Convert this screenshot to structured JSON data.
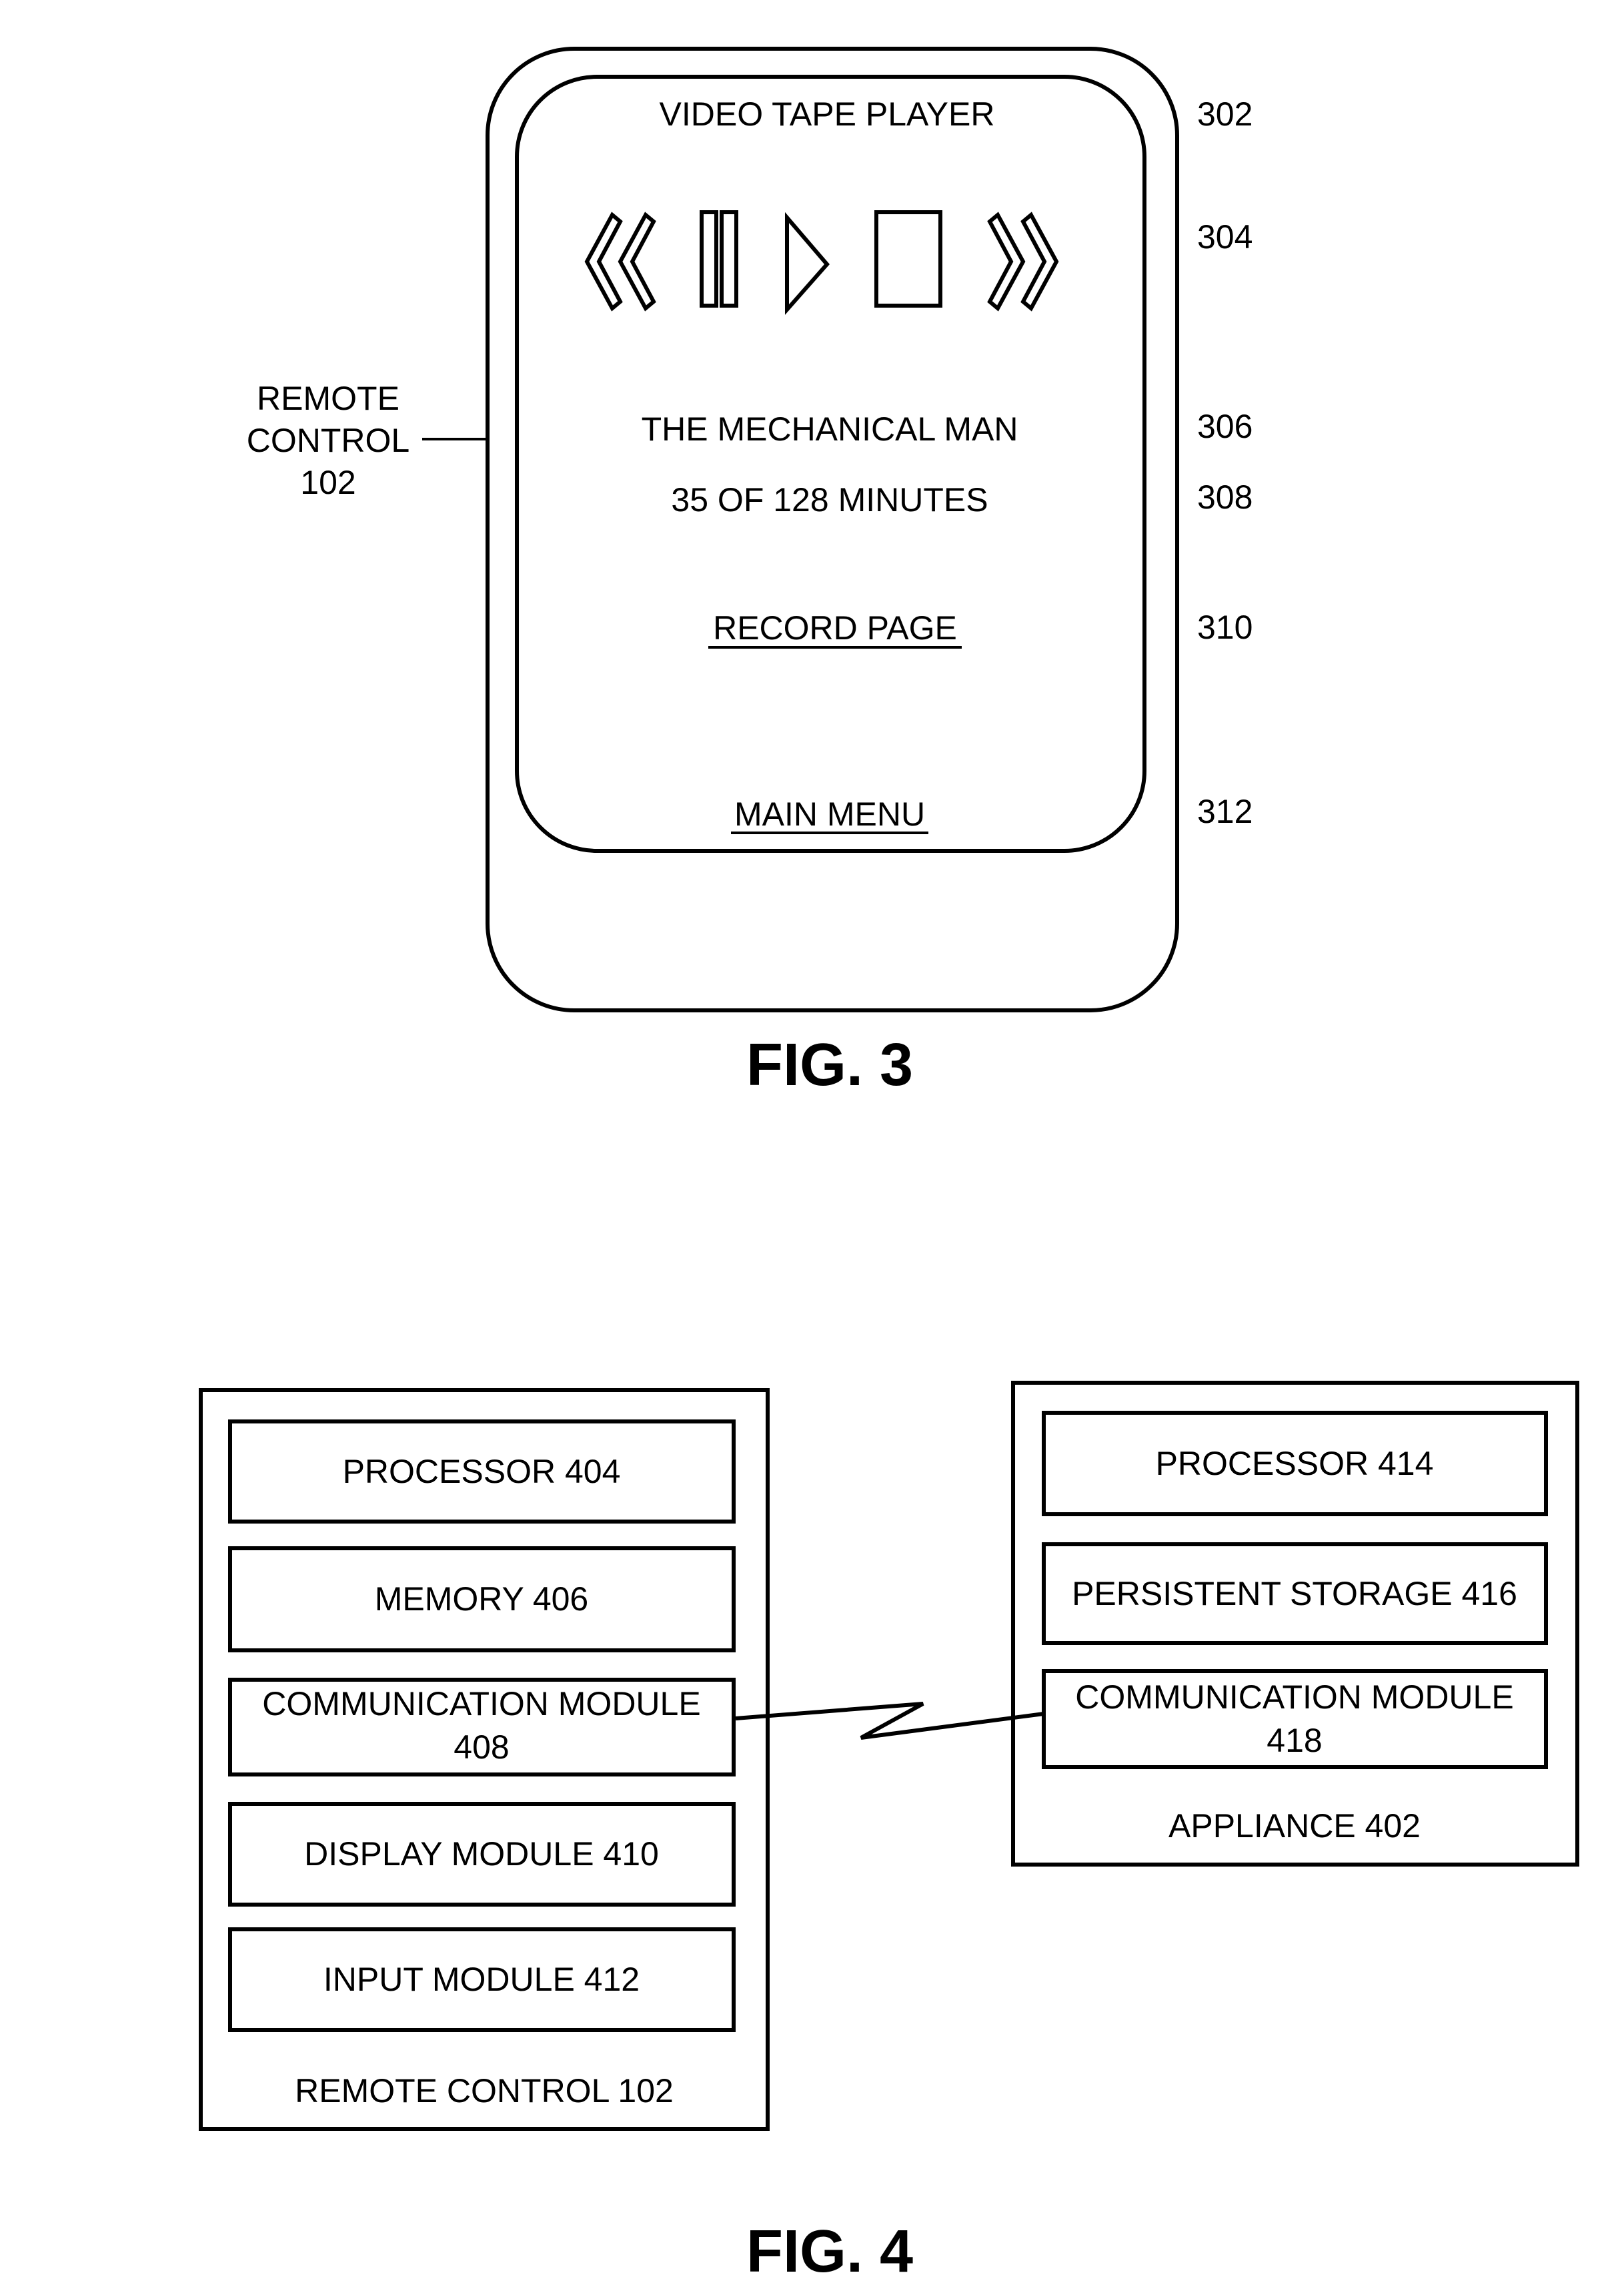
{
  "figure3": {
    "caption": "FIG. 3",
    "device_label": {
      "lines": [
        "REMOTE",
        "CONTROL",
        "102"
      ]
    },
    "screen": {
      "title": "VIDEO TAPE PLAYER",
      "controls": [
        {
          "name": "rewind",
          "icon": "rewind-icon"
        },
        {
          "name": "pause",
          "icon": "pause-icon"
        },
        {
          "name": "play",
          "icon": "play-icon"
        },
        {
          "name": "stop",
          "icon": "stop-icon"
        },
        {
          "name": "fast-forward",
          "icon": "fast-forward-icon"
        }
      ],
      "program_title": "THE MECHANICAL MAN",
      "progress_text": "35 OF 128 MINUTES",
      "progress": {
        "current_minutes": 35,
        "total_minutes": 128
      },
      "record_link": "RECORD PAGE",
      "main_menu_link": "MAIN MENU"
    },
    "reference_numerals": [
      "302",
      "304",
      "306",
      "308",
      "310",
      "312"
    ]
  },
  "figure4": {
    "caption": "FIG. 4",
    "remote_control": {
      "label": "REMOTE CONTROL 102",
      "modules": [
        {
          "lines": [
            "PROCESSOR 404"
          ]
        },
        {
          "lines": [
            "MEMORY 406"
          ]
        },
        {
          "lines": [
            "COMMUNICATION MODULE",
            "408"
          ]
        },
        {
          "lines": [
            "DISPLAY MODULE 410"
          ]
        },
        {
          "lines": [
            "INPUT MODULE 412"
          ]
        }
      ]
    },
    "appliance": {
      "label": "APPLIANCE 402",
      "modules": [
        {
          "lines": [
            "PROCESSOR 414"
          ]
        },
        {
          "lines": [
            "PERSISTENT STORAGE 416"
          ]
        },
        {
          "lines": [
            "COMMUNICATION MODULE",
            "418"
          ]
        }
      ]
    },
    "link": "wireless-link"
  }
}
